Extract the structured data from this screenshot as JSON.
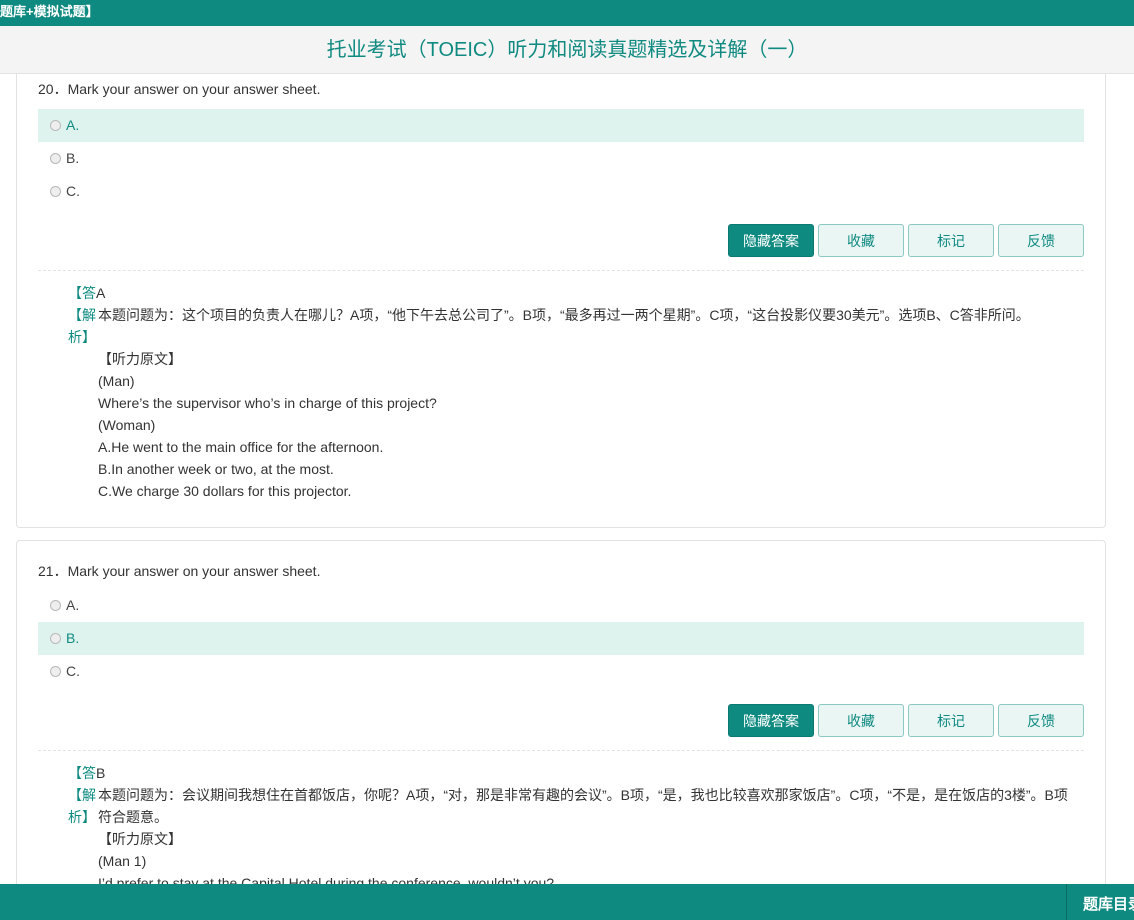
{
  "header": {
    "breadcrumb": "题库+模拟试题】",
    "title": "托业考试（TOEIC）听力和阅读真题精选及详解（一）"
  },
  "questions": [
    {
      "text": "20．Mark your answer on your answer sheet.",
      "options": [
        "A.",
        "B.",
        "C."
      ],
      "selected": "A.",
      "buttons": {
        "hide": "隐藏答案",
        "favorite": "收藏",
        "mark": "标记",
        "feedback": "反馈"
      },
      "answer_label": "【答",
      "answer_letter": "A",
      "analysis_label": "【解析】",
      "analysis_text": "本题问题为：这个项目的负责人在哪儿？A项，“他下午去总公司了”。B项，“最多再过一两个星期”。C项，“这台投影仪要30美元”。选项B、C答非所问。",
      "transcript_label": "【听力原文】",
      "transcript": [
        "(Man)",
        "Where’s the supervisor who’s in charge of this project?",
        "(Woman)",
        "A.He went to the main office for the afternoon.",
        "B.In another week or two, at the most.",
        "C.We charge 30 dollars for this projector."
      ]
    },
    {
      "text": "21．Mark your answer on your answer sheet.",
      "options": [
        "A.",
        "B.",
        "C."
      ],
      "selected": "B.",
      "buttons": {
        "hide": "隐藏答案",
        "favorite": "收藏",
        "mark": "标记",
        "feedback": "反馈"
      },
      "answer_label": "【答",
      "answer_letter": "B",
      "analysis_label": "【解析】",
      "analysis_text": "本题问题为：会议期间我想住在首都饭店，你呢？A项，“对，那是非常有趣的会议”。B项，“是，我也比较喜欢那家饭店”。C项，“不是，是在饭店的3楼”。B项符合题意。",
      "transcript_label": "【听力原文】",
      "transcript": [
        "(Man 1)",
        "I’d prefer to stay at the Capital Hotel during the conference, wouldn’t you?"
      ]
    }
  ],
  "footer": {
    "catalog_label": "题库目录"
  },
  "colors": {
    "accent": "#0f8a80",
    "selected_bg": "#dff3ee"
  }
}
